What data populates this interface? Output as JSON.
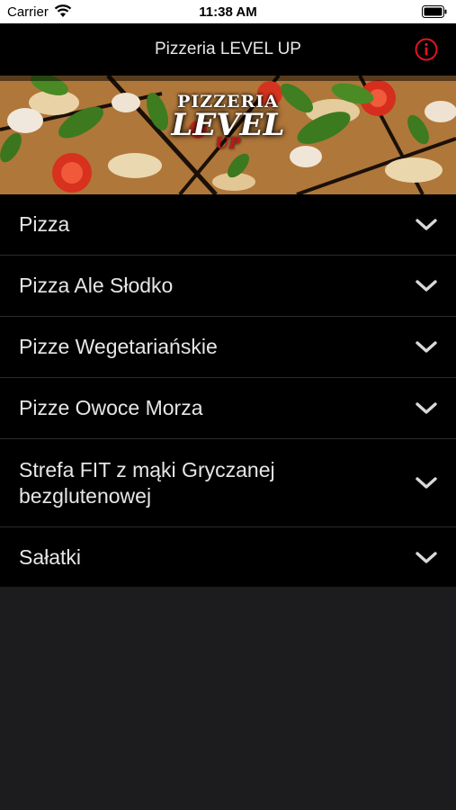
{
  "status_bar": {
    "carrier": "Carrier",
    "time": "11:38 AM"
  },
  "header": {
    "title": "Pizzeria LEVEL UP"
  },
  "banner": {
    "logo_top": "PIZZERIA",
    "logo_main": "LEVEL",
    "logo_sub": "UP"
  },
  "menu": {
    "items": [
      {
        "label": "Pizza"
      },
      {
        "label": "Pizza Ale Słodko"
      },
      {
        "label": "Pizze Wegetariańskie"
      },
      {
        "label": "Pizze Owoce Morza"
      },
      {
        "label": "Strefa FIT z mąki Gryczanej bezglutenowej"
      },
      {
        "label": "Sałatki"
      }
    ]
  },
  "colors": {
    "accent": "#e0141e",
    "row_bg": "#000000",
    "page_bg": "#1c1c1e"
  }
}
